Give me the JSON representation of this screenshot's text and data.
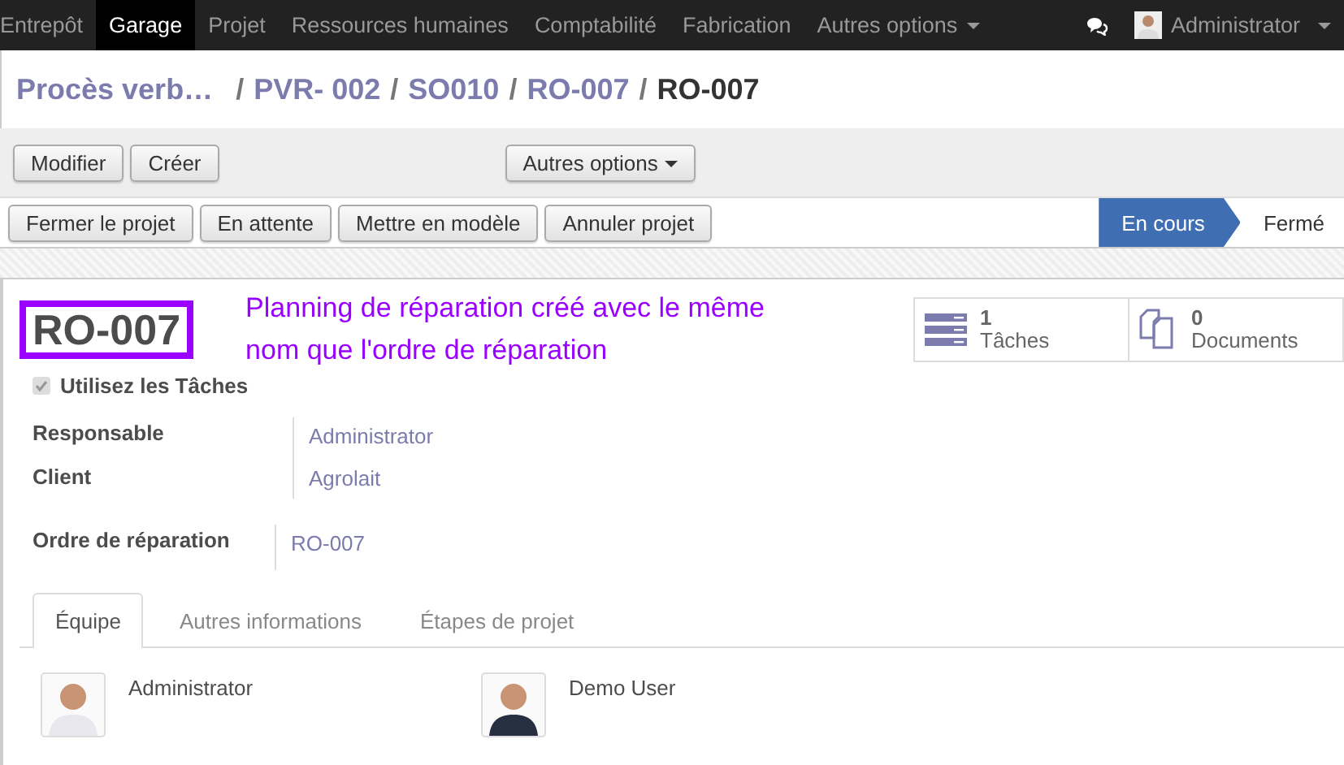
{
  "top_menu": [
    {
      "label": "Entrepôt",
      "selected": false
    },
    {
      "label": "Garage",
      "selected": true
    },
    {
      "label": "Projet",
      "selected": false
    },
    {
      "label": "Ressources humaines",
      "selected": false
    },
    {
      "label": "Comptabilité",
      "selected": false
    },
    {
      "label": "Fabrication",
      "selected": false
    },
    {
      "label": "Autres options",
      "selected": false,
      "dropdown": true
    }
  ],
  "user": {
    "name": "Administrator"
  },
  "breadcrumb_separator": "/",
  "breadcrumb": [
    {
      "label": "Procès verb…",
      "current": false
    },
    {
      "label": "PVR- 002",
      "current": false
    },
    {
      "label": "SO010",
      "current": false
    },
    {
      "label": "RO-007",
      "current": false
    },
    {
      "label": "RO-007",
      "current": true
    }
  ],
  "actions": {
    "left": [
      "Modifier",
      "Créer"
    ],
    "more": "Autres options"
  },
  "status_buttons": [
    "Fermer le projet",
    "En attente",
    "Mettre en modèle",
    "Annuler projet"
  ],
  "stages": [
    {
      "label": "En cours",
      "selected": true
    },
    {
      "label": "Fermé",
      "selected": false
    }
  ],
  "record": {
    "title": "RO-007",
    "annotation": [
      "Planning de réparation créé avec le même",
      "nom que l'ordre de réparation"
    ],
    "stats": [
      {
        "kind": "tasks",
        "count": "1",
        "label": "Tâches"
      },
      {
        "kind": "documents",
        "count": "0",
        "label": "Documents"
      }
    ],
    "use_tasks": {
      "label": "Utilisez les Tâches",
      "checked": true
    },
    "fields": [
      {
        "label": "Responsable",
        "value": "Administrator"
      },
      {
        "label": "Client",
        "value": "Agrolait"
      }
    ],
    "order_field": {
      "label": "Ordre de réparation",
      "value": "RO-007"
    }
  },
  "tabs": [
    {
      "label": "Équipe",
      "selected": true
    },
    {
      "label": "Autres informations",
      "selected": false
    },
    {
      "label": "Étapes de projet",
      "selected": false
    }
  ],
  "team": [
    {
      "name": "Administrator"
    },
    {
      "name": "Demo User"
    }
  ]
}
